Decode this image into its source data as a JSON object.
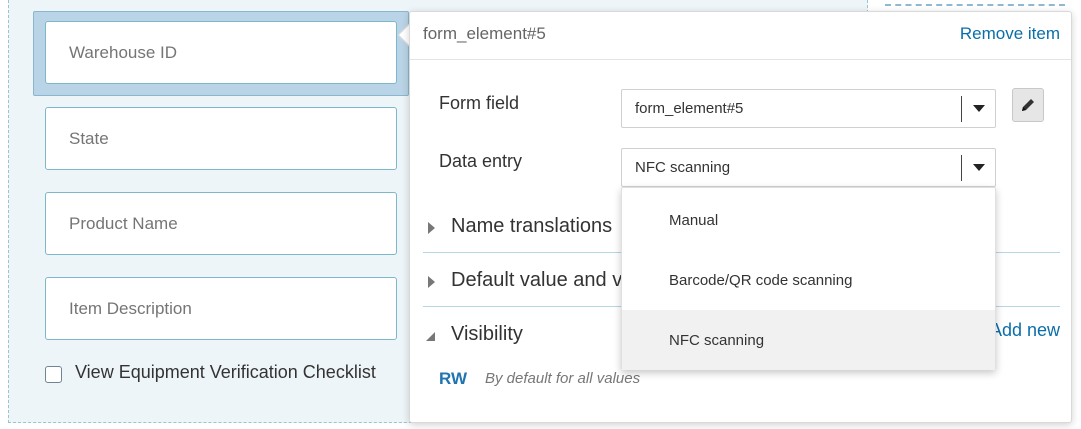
{
  "form_canvas": {
    "fields": [
      {
        "placeholder": "Warehouse ID"
      },
      {
        "placeholder": "State"
      },
      {
        "placeholder": "Product Name"
      },
      {
        "placeholder": "Item Description"
      }
    ],
    "checkbox": {
      "label": "View Equipment Verification Checklist",
      "checked": false
    }
  },
  "panel": {
    "title": "form_element#5",
    "remove_label": "Remove item",
    "form_field": {
      "label": "Form field",
      "value": "form_element#5"
    },
    "data_entry": {
      "label": "Data entry",
      "value": "NFC scanning",
      "options": [
        "Manual",
        "Barcode/QR code scanning",
        "NFC scanning"
      ]
    },
    "sections": [
      {
        "label": "Name translations",
        "expanded": false
      },
      {
        "label": "Default value and v",
        "expanded": false
      },
      {
        "label": "Visibility",
        "expanded": true
      }
    ],
    "add_new_label": "Add new",
    "visibility_rule": {
      "access": "RW",
      "note": "By default for all values"
    }
  },
  "colors": {
    "accent_link": "#0a6ea8",
    "selected_field_bg": "#b9d4e6",
    "rw": "#1f74b1"
  },
  "icons": {
    "edit": "pencil-icon",
    "dropdown": "chevron-down-icon",
    "expand": "triangle-right-icon",
    "collapse": "triangle-down-icon"
  }
}
